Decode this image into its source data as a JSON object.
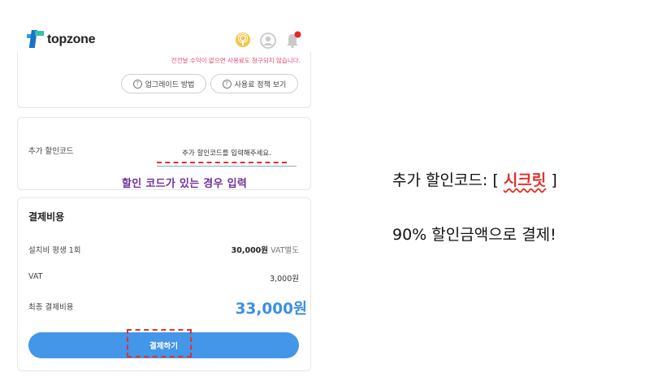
{
  "header": {
    "brand": "topzone",
    "icons": [
      "podcast-icon",
      "user-icon",
      "bell-icon"
    ]
  },
  "usage_card": {
    "notice": "전전날 수익이 없으면 사용료도 청구되지 않습니다.",
    "buttons": [
      "업그레이드 방법",
      "사용료 정책 보기"
    ]
  },
  "promo": {
    "label": "추가 할인코드",
    "placeholder": "추가 할인코드를 입력해주세요.",
    "hint": "할인 코드가 있는 경우 입력"
  },
  "payment": {
    "title": "결제비용",
    "rows": [
      {
        "label": "설치비 평생 1회",
        "value": "30,000원",
        "suffix": "VAT별도"
      },
      {
        "label": "VAT",
        "value": "3,000원",
        "suffix": ""
      }
    ],
    "total_label": "최종 결제비용",
    "total_value": "33,000원",
    "pay_button": "결제하기"
  },
  "annotation": {
    "line1_prefix": "추가 할인코드: [ ",
    "line1_code": "시크릿",
    "line1_suffix": " ]",
    "line2": "90% 할인금액으로 결제!"
  },
  "colors": {
    "accent": "#4396e8",
    "total": "#3d8fe0",
    "highlight_red": "#e0322c",
    "hint_purple": "#7030a0",
    "notice_pink": "#e2466e",
    "notification_dot": "#e8262b"
  }
}
